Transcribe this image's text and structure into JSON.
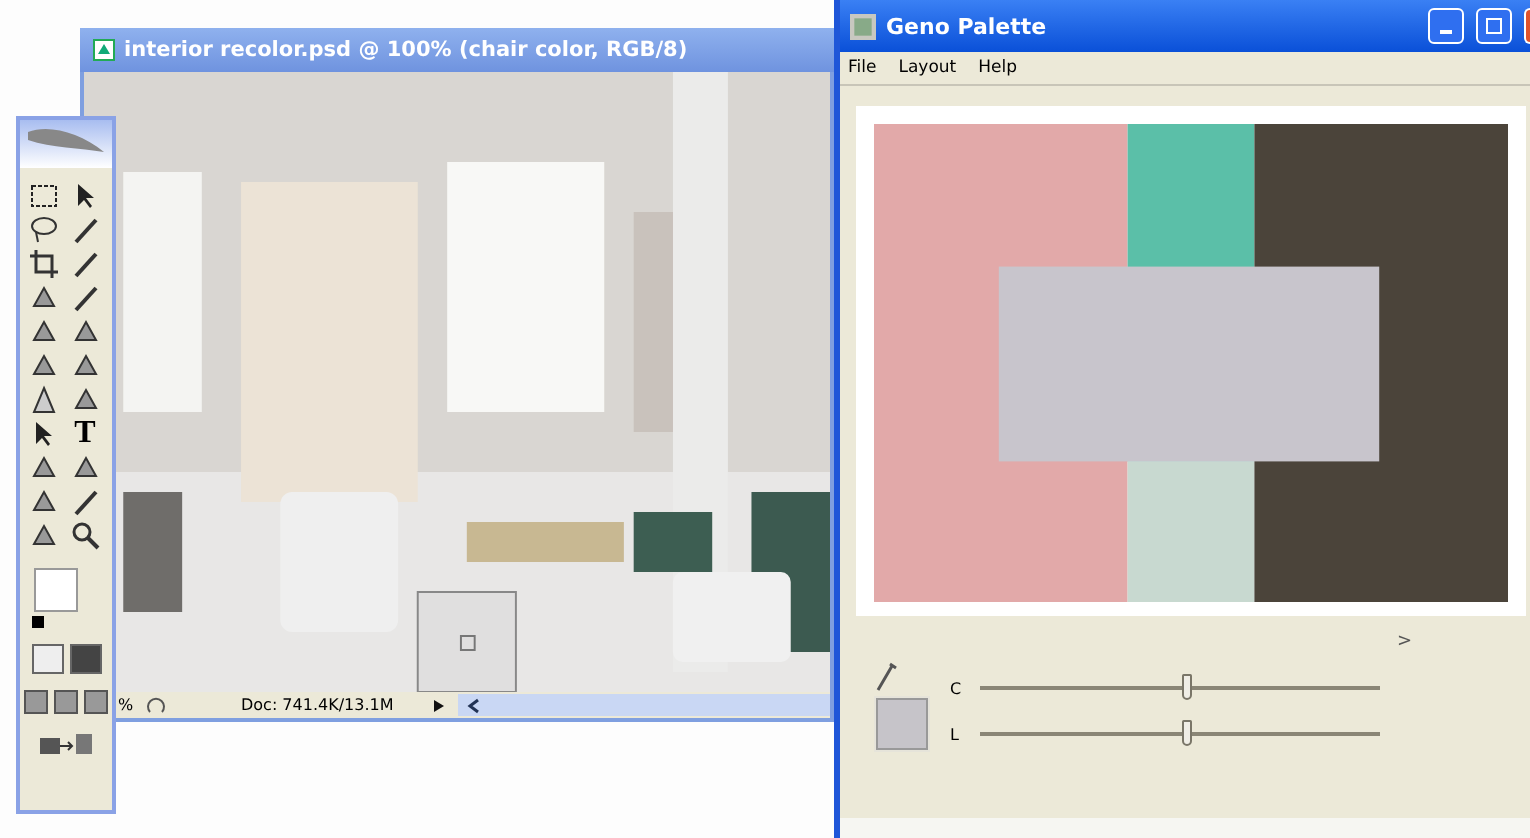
{
  "photoshop_window": {
    "title": "interior recolor.psd @ 100% (chair color, RGB/8)",
    "status_bar": {
      "zoom": "%",
      "doc_info": "Doc: 741.4K/13.1M"
    }
  },
  "toolbox": {
    "type_tool": "T"
  },
  "geno_window": {
    "title": "Geno Palette",
    "menu": [
      "File",
      "Layout",
      "Help"
    ],
    "palette": {
      "columns": [
        {
          "segments": [
            {
              "color": "#e2a9a9"
            }
          ]
        },
        {
          "segments": [
            {
              "color": "#5bbfa8"
            },
            {
              "color": "#c8d9d0"
            }
          ]
        },
        {
          "segments": [
            {
              "color": "#4b443a"
            }
          ]
        }
      ],
      "overlay": {
        "color": "#c8c5cc"
      }
    },
    "expand": ">",
    "swatch": {
      "color": "#c6c4c9"
    },
    "sliders": [
      {
        "label": "C",
        "level": 0.52
      },
      {
        "label": "L",
        "level": 0.52
      }
    ]
  }
}
